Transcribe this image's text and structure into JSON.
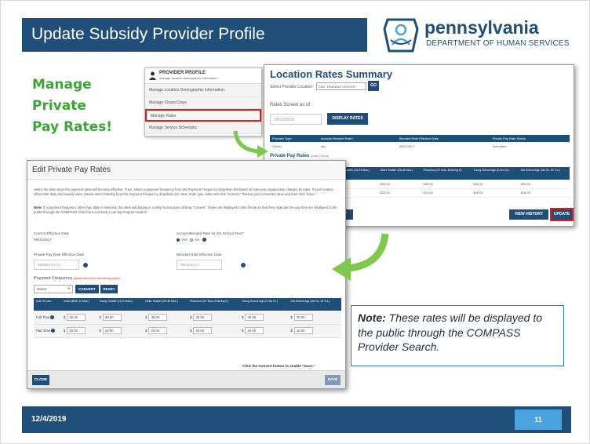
{
  "slide": {
    "title": "Update Subsidy Provider Profile",
    "logo_name": "pennsylvania",
    "logo_dept": "DEPARTMENT OF HUMAN SERVICES",
    "heading_lines": [
      "Manage",
      "Private",
      "Pay Rates!"
    ],
    "footer_date": "12/4/2019",
    "page_number": "11",
    "note_prefix": "Note:",
    "note_text": " These rates will be displayed to the public through the COMPASS Provider Search."
  },
  "profile_menu": {
    "title": "PROVIDER PROFILE",
    "subtitle": "Manage location demographic information",
    "items": [
      "Manage Location Demographic Information",
      "Manage Closed Days",
      "Manage Rates",
      "Manage Service Schedules"
    ]
  },
  "summary": {
    "title": "Location Rates Summary",
    "select_label": "Select Provider Location:",
    "select_value": "CAIT TRAINING CENTER",
    "go_label": "GO",
    "rates_as_of_label": "Rates Screen as of:",
    "rates_date": "09/12/2018",
    "display_rates_label": "DISPLAY RATES",
    "table_headers": [
      "Provider Type",
      "Accepts Blended Rate?",
      "Blended Rate Effective Date",
      "Private Pay Rate Status"
    ],
    "table_row": [
      "Center",
      "Yes",
      "09/01/2017",
      "Submitted"
    ],
    "ppr_label": "Private Pay Rates",
    "ppr_note": "(Daily Rates)",
    "ppr_headers": [
      "Young Toddler (13-24 Mos.)",
      "Older Toddler (25-36 Mos.)",
      "Preschool (37 Mos.-Entering K)",
      "Young School Age (K-3rd Gr.)",
      "Old School Age (4th Gr.-15 Yrs.)"
    ],
    "ppr_rows": [
      [
        "$35.00",
        "$35.00",
        "$35.00",
        "$30.00",
        "$30.00"
      ],
      [
        "$20.00",
        "$20.00",
        "$20.00",
        "$18.00",
        "$18.00"
      ]
    ],
    "summary_btn": "MARY",
    "view_history": "VIEW HISTORY",
    "update": "UPDATE"
  },
  "edit": {
    "title": "Edit Private Pay Rates",
    "instructions": "Select the date when the payment rates will become effective. Then, select a payment frequency from the Payment Frequency dropdown list based on how your organization charges its rates. If your location offers both daily and weekly rates, please select Weekly from the Payment Frequency dropdown list. Next, enter your rates and click \"Convert.\" Review your converted rates and then click \"Save.\"",
    "note_bold": "Note:",
    "note_text": " If a payment frequency other than daily is selected, the rates will display in a daily format upon clicking \"Convert.\" Rates are displayed in this format so that they replicate the way they are displayed to the public through the COMPASS Child Care and Early Learning Program Search.",
    "current_date_label": "Current Effective Date",
    "current_date_value": "09/01/2017",
    "accept_label": "Accept Blended Rate for the School Year?",
    "yes_label": "Yes",
    "no_label": "No",
    "ppr_date_label": "Private Pay Rate Effective Date",
    "ppr_date_placeholder": "MM/DD/YYYY",
    "blended_date_label": "Blended Rate Effective Date",
    "blended_date_value": "09/01/2017",
    "payment_freq_label": "Payment Frequency",
    "payment_freq_note": "(Must select prior to entering rates)",
    "select_value": "Select",
    "convert_label": "CONVERT",
    "reset_label": "RESET",
    "table_headers": [
      "Unit Of Care",
      "Infant (Birth-12 Mos.)",
      "Young Toddler (13-24 Mos.)",
      "Older Toddler (25-36 Mos.)",
      "Preschool (37 Mos.-Entering K)",
      "Young School Age (K-3rd Gr.)",
      "Old School Age (4th Gr.-15 Yrs.)"
    ],
    "rows": [
      {
        "unit": "Full Time",
        "values": [
          "35.00",
          "35.00",
          "35.00",
          "35.00",
          "30.00",
          "30.00"
        ]
      },
      {
        "unit": "Part Time",
        "values": [
          "20.00",
          "20.00",
          "20.00",
          "20.00",
          "18.00",
          "18.00"
        ]
      }
    ],
    "convert_hint": "Click the Convert button to enable \"Save.\"",
    "close_label": "CLOSE",
    "save_label": "SAVE"
  },
  "colors": {
    "banner": "#1f4e79",
    "accent_green": "#3aa632",
    "highlight_red": "#e01c1c",
    "page_badge": "#4aa3df"
  }
}
